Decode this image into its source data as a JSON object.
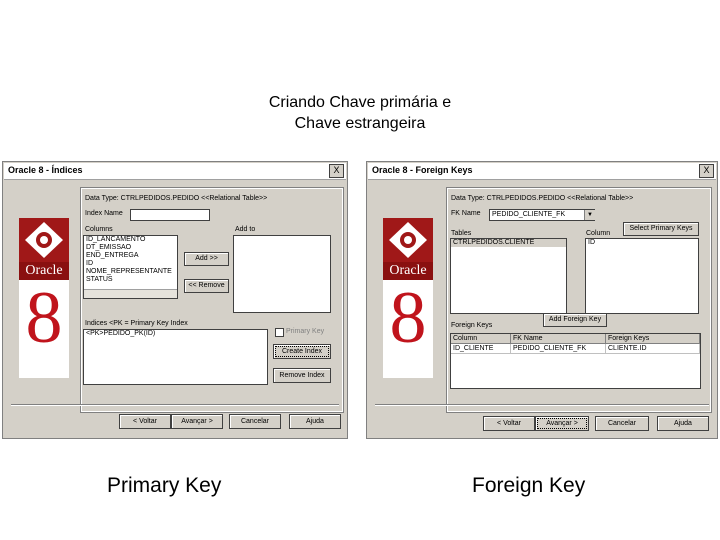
{
  "slide": {
    "title_line1": "Criando Chave primária e",
    "title_line2": "Chave estrangeira",
    "caption_left": "Primary Key",
    "caption_right": "Foreign Key"
  },
  "logo": {
    "brand": "Oracle",
    "version": "8"
  },
  "left_window": {
    "title": "Oracle 8 - Índices",
    "close": "X",
    "data_type_label": "Data Type: CTRLPEDIDOS.PEDIDO <<Relational Table>>",
    "index_name_label": "Index Name",
    "index_name_value": "",
    "columns_label": "Columns",
    "columns": [
      "ID_LANCAMENTO",
      "DT_EMISSAO",
      "END_ENTREGA",
      "ID",
      "NOME_REPRESENTANTE",
      "STATUS"
    ],
    "add_to_label": "Add to",
    "add_button": "Add >>",
    "remove_button": "<< Remove",
    "indices_label": "Indices <PK = Primary Key Index",
    "indices": [
      "<PK>PEDIDO_PK(ID)"
    ],
    "primary_key_checkbox": "Primary Key",
    "create_index_button": "Create Index",
    "remove_index_button": "Remove Index",
    "back_button": "< Voltar",
    "next_button": "Avançar >",
    "cancel_button": "Cancelar",
    "help_button": "Ajuda"
  },
  "right_window": {
    "title": "Oracle 8 - Foreign Keys",
    "close": "X",
    "data_type_label": "Data Type: CTRLPEDIDOS.PEDIDO <<Relational Table>>",
    "fk_name_label": "FK Name",
    "fk_name_value": "PEDIDO_CLIENTE_FK",
    "select_pk_button": "Select Primary Keys",
    "tables_label": "Tables",
    "tables": [
      "CTRLPEDIDOS.CLIENTE"
    ],
    "column_label": "Column",
    "columns": [
      "ID"
    ],
    "add_fk_button": "Add Foreign Key",
    "foreign_keys_label": "Foreign Keys",
    "fk_grid": {
      "headers": [
        "Column",
        "FK Name",
        "Foreign Keys"
      ],
      "rows": [
        [
          "ID_CLIENTE",
          "PEDIDO_CLIENTE_FK",
          "CLIENTE.ID"
        ]
      ]
    },
    "back_button": "< Voltar",
    "next_button": "Avançar >",
    "cancel_button": "Cancelar",
    "help_button": "Ajuda"
  }
}
